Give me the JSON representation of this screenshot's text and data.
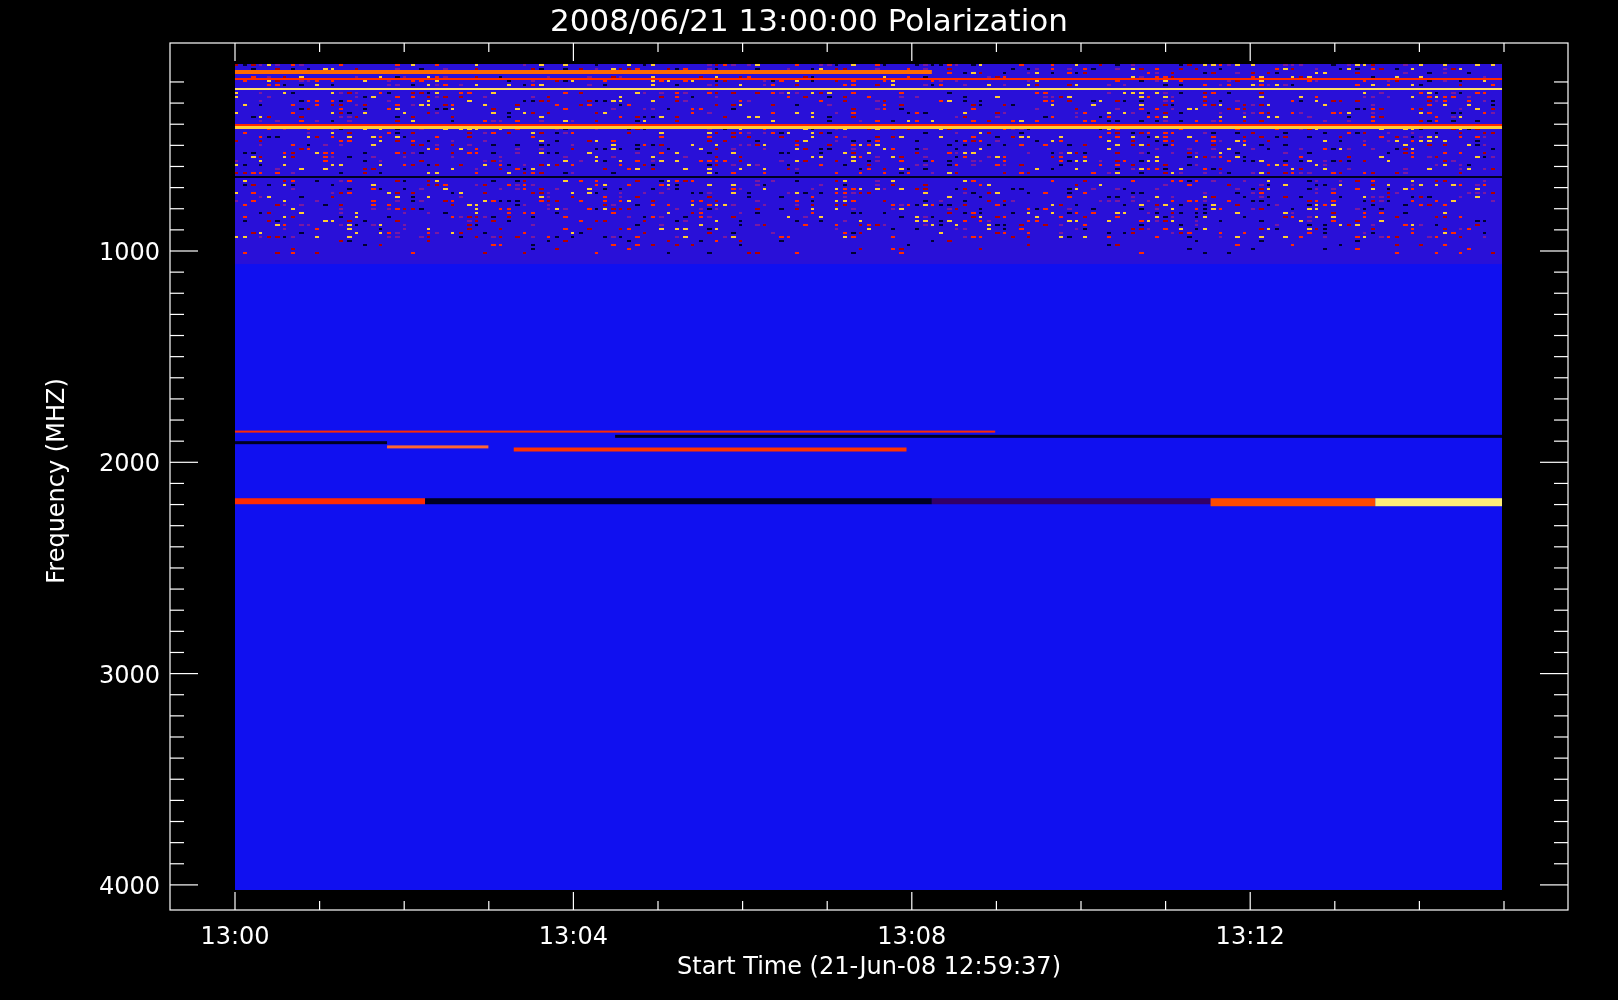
{
  "title": "2008/06/21 13:00:00 Polarization",
  "y_axis": {
    "label": "Frequency (MHZ)",
    "ticks": [
      "1000",
      "2000",
      "3000",
      "4000"
    ]
  },
  "x_axis": {
    "label": "Start Time (21-Jun-08 12:59:37)",
    "ticks": [
      "13:00",
      "13:04",
      "13:08",
      "13:12"
    ]
  }
}
